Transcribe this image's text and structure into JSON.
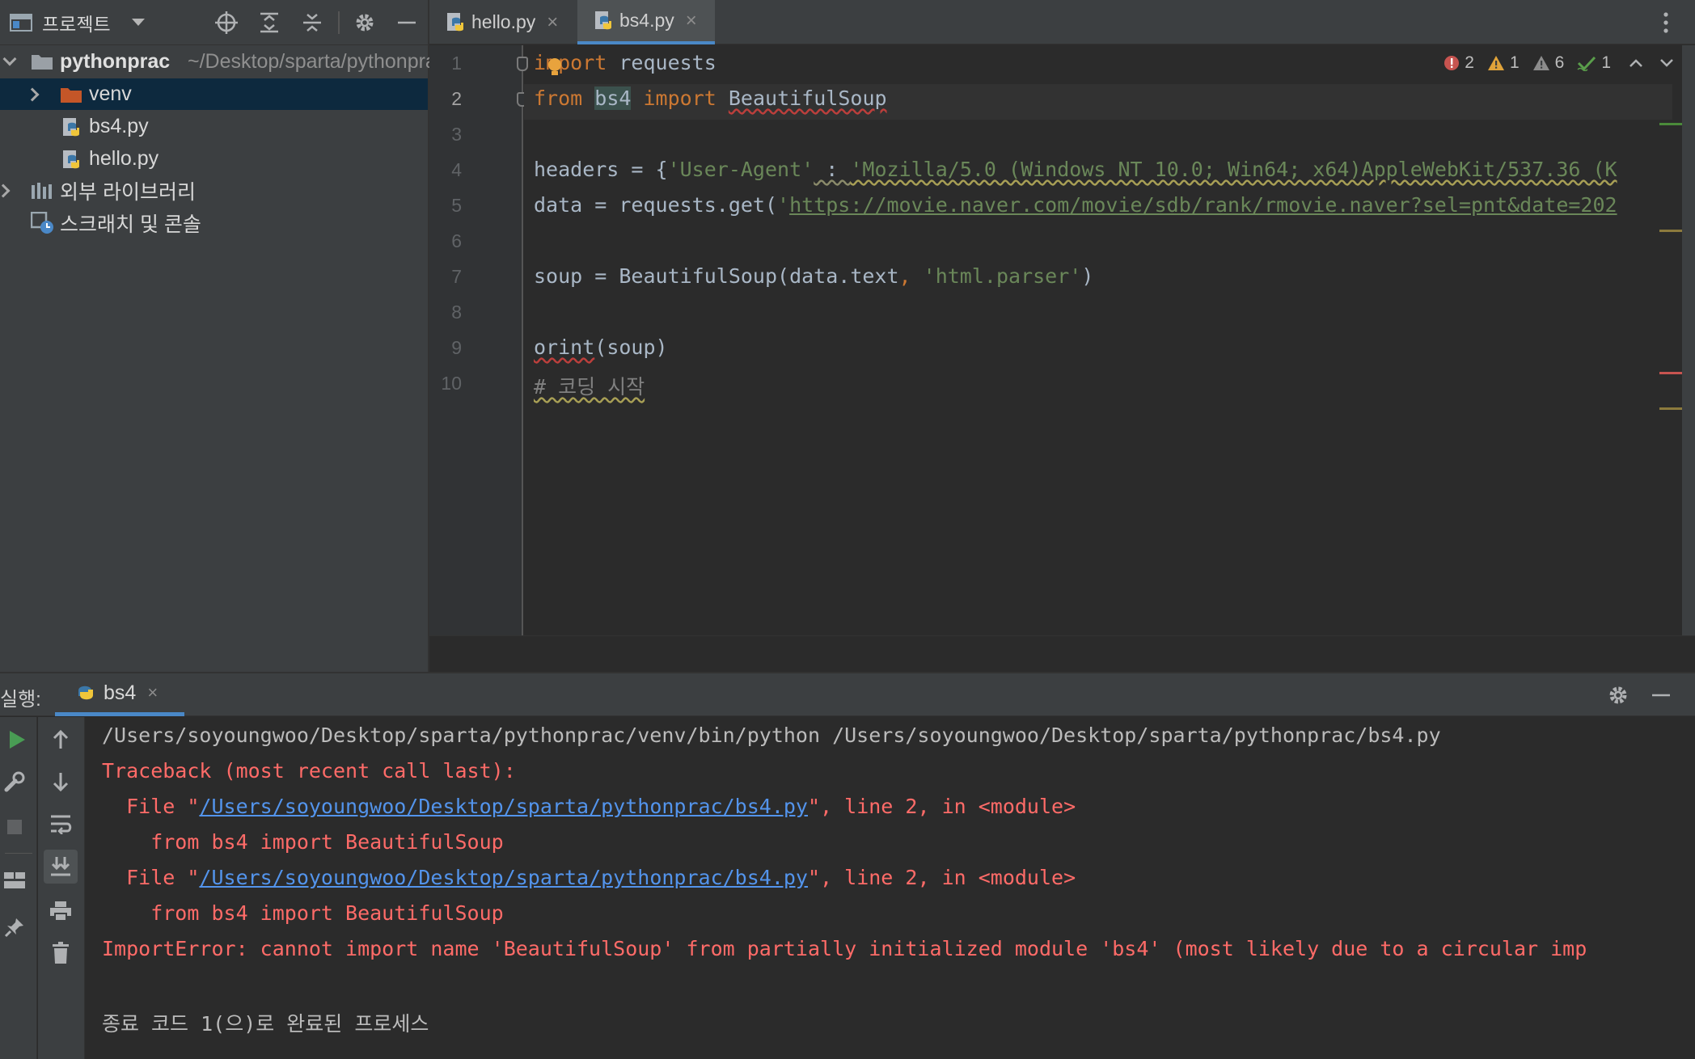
{
  "project_panel": {
    "title": "프로젝트",
    "root": {
      "name": "pythonprac",
      "path": "~/Desktop/sparta/pythonprac"
    },
    "items": [
      {
        "label": "venv"
      },
      {
        "label": "bs4.py"
      },
      {
        "label": "hello.py"
      },
      {
        "label": "외부 라이브러리"
      },
      {
        "label": "스크래치 및 콘솔"
      }
    ]
  },
  "editor": {
    "tabs": [
      {
        "label": "hello.py"
      },
      {
        "label": "bs4.py"
      }
    ],
    "inspections": {
      "errors": "2",
      "warnings": "1",
      "weak_warnings": "6",
      "typos": "1"
    },
    "line_numbers": [
      "1",
      "2",
      "3",
      "4",
      "5",
      "6",
      "7",
      "8",
      "9",
      "10"
    ],
    "code": {
      "l1_kw": "import",
      "l1_rest": " requests",
      "l2_kw1": "from",
      "l2_mod": "bs4",
      "l2_kw2": "import",
      "l2_name": "BeautifulSoup",
      "l4_a": "headers = {",
      "l4_key": "'User-Agent'",
      "l4_b": " : ",
      "l4_val": "'Mozilla/5.0 (Windows NT 10.0; Win64; x64)AppleWebKit/537.36 (K",
      "l5_a": "data = requests.get(",
      "l5_q": "'",
      "l5_url": "https://movie.naver.com/movie/sdb/rank/rmovie.naver?sel=pnt&date=202",
      "l7_a": "soup = BeautifulSoup(data.text",
      "l7_comma": ", ",
      "l7_str": "'html.parser'",
      "l7_b": ")",
      "l9_fn": "orint",
      "l9_rest": "(soup)",
      "l10": "# 코딩 시작"
    }
  },
  "run_panel": {
    "label": "실행:",
    "tab": "bs4",
    "output": {
      "cmd": "/Users/soyoungwoo/Desktop/sparta/pythonprac/venv/bin/python /Users/soyoungwoo/Desktop/sparta/pythonprac/bs4.py",
      "traceback": "Traceback (most recent call last):",
      "file_prefix": "  File \"",
      "file_path": "/Users/soyoungwoo/Desktop/sparta/pythonprac/bs4.py",
      "file_suffix": "\", line 2, in <module>",
      "code_line": "    from bs4 import BeautifulSoup",
      "error": "ImportError: cannot import name 'BeautifulSoup' from partially initialized module 'bs4' (most likely due to a circular imp",
      "exit": "종료 코드 1(으)로 완료된 프로세스"
    }
  }
}
